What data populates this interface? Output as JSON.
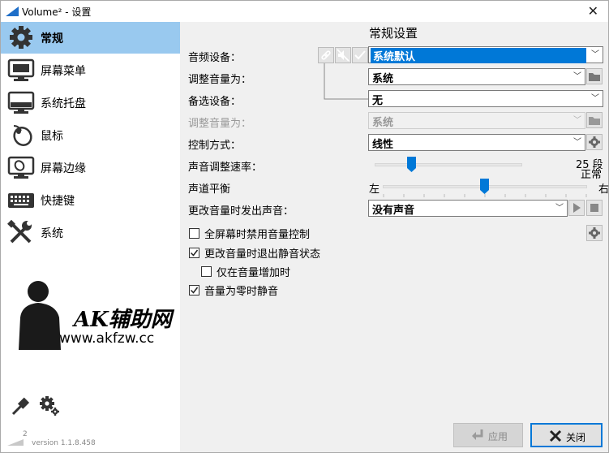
{
  "window": {
    "title": "Volume² - 设置"
  },
  "sidebar": {
    "items": [
      {
        "label": "常规",
        "icon": "gear-icon",
        "active": true
      },
      {
        "label": "屏幕菜单",
        "icon": "monitor-menu-icon"
      },
      {
        "label": "系统托盘",
        "icon": "tray-icon"
      },
      {
        "label": "鼠标",
        "icon": "mouse-icon"
      },
      {
        "label": "屏幕边缘",
        "icon": "screen-edge-icon"
      },
      {
        "label": "快捷键",
        "icon": "keyboard-icon"
      },
      {
        "label": "系统",
        "icon": "tools-icon"
      }
    ],
    "watermark": {
      "logo": "AK辅助网",
      "url": "www.akfzw.cc"
    },
    "version": "version 1.1.8.458",
    "version_badge": "2"
  },
  "main": {
    "title": "常规设置",
    "audio_device": {
      "label": "音频设备：",
      "value": "系统默认"
    },
    "adjust_volume": {
      "label": "调整音量为：",
      "value": "系统"
    },
    "alt_device": {
      "label": "备选设备：",
      "value": "无"
    },
    "adjust_volume_alt": {
      "label": "调整音量为：",
      "value": "系统"
    },
    "control_mode": {
      "label": "控制方式：",
      "value": "线性"
    },
    "volume_speed": {
      "label": "声音调整速率：",
      "value_text": "25 段",
      "level": 0.28
    },
    "balance": {
      "label": "声道平衡",
      "left": "左",
      "right": "右",
      "center_text": "正常",
      "level": 0.5
    },
    "change_sound": {
      "label": "更改音量时发出声音：",
      "value": "没有声音"
    },
    "checkboxes": [
      {
        "label": "全屏幕时禁用音量控制",
        "checked": false
      },
      {
        "label": "更改音量时退出静音状态",
        "checked": true
      },
      {
        "label": "仅在音量增加时",
        "checked": false
      },
      {
        "label": "音量为零时静音",
        "checked": true
      }
    ]
  },
  "footer": {
    "apply_label": "应用",
    "close_label": "关闭"
  },
  "colors": {
    "accent": "#0078d7",
    "selected_nav": "#99c9ef"
  }
}
